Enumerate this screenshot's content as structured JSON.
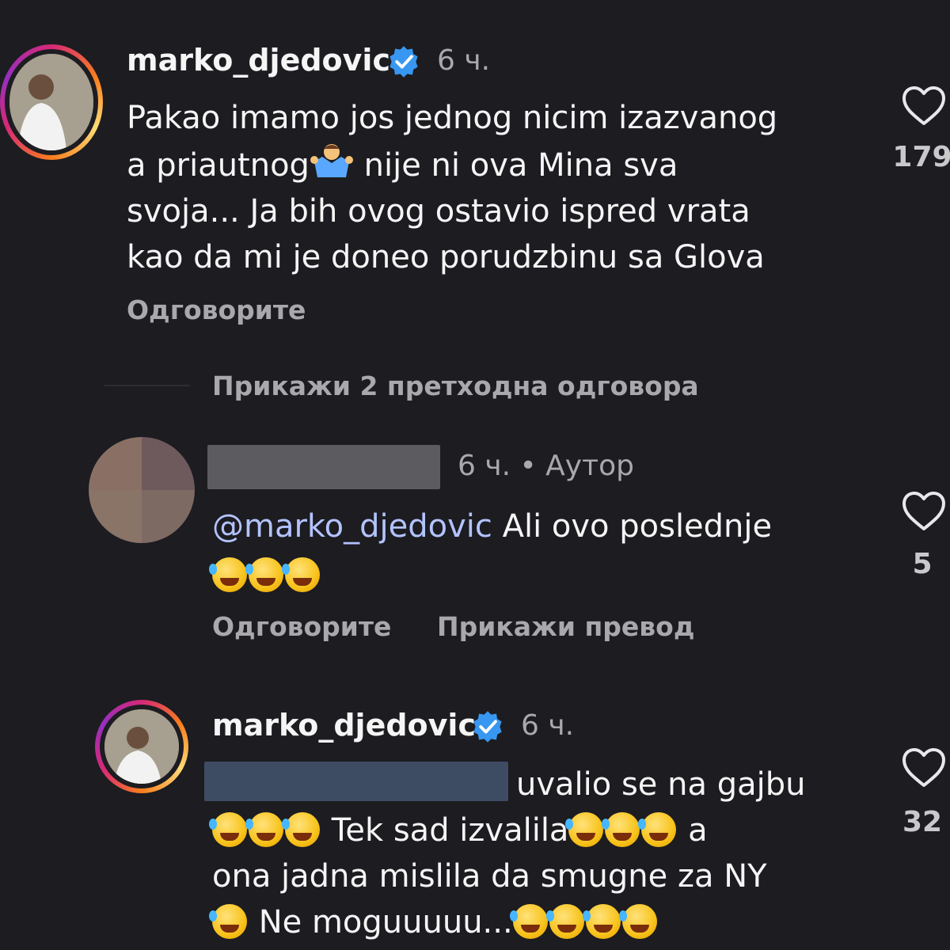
{
  "comments": [
    {
      "username": "marko_djedovic",
      "time": "6 ч.",
      "lines": [
        "Pakao imamo jos jednog nicim izazvanog",
        "a priautnog",
        "nije ni ova Mina sva",
        "svoja... Ja bih ovog ostavio ispred vrata",
        "kao da mi je doneo porudzbinu sa Glova"
      ],
      "reply_label": "Одговорите",
      "likes": "179"
    },
    {
      "time_author": "6 ч. • Аутор",
      "mention": "@marko_djedovic",
      "text": " Ali ovo poslednje",
      "reply_label": "Одговорите",
      "translate_label": "Прикажи превод",
      "likes": "5"
    },
    {
      "username": "marko_djedovic",
      "time": "6 ч.",
      "line1": "uvalio se na gajbu",
      "line2": " Tek sad izvalila",
      "line2b": " a",
      "line3": "ona jadna mislila da smugne za NY",
      "line4": " Ne moguuuuu...",
      "likes": "32"
    }
  ],
  "show_previous_replies": "Прикажи 2 претходна одговора",
  "colors": {
    "background": "#1c1c21",
    "verified": "#3897f0",
    "mention": "#b3c3ff",
    "secondary_text": "#a8a8ad"
  },
  "icons": [
    "verified-badge-icon",
    "heart-icon",
    "shrug-emoji",
    "rofl-emoji"
  ]
}
